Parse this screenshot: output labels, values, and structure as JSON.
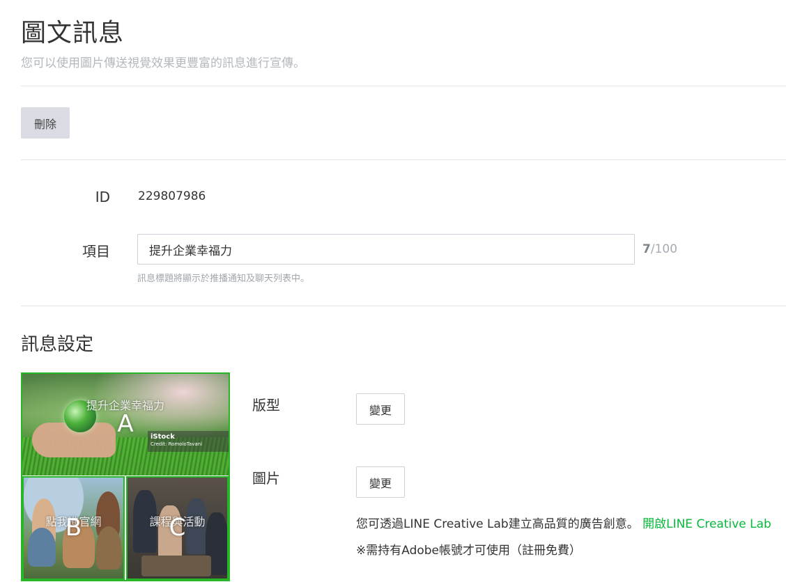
{
  "header": {
    "title": "圖文訊息",
    "subtitle": "您可以使用圖片傳送視覺效果更豐富的訊息進行宣傳。"
  },
  "actions": {
    "delete_label": "刪除"
  },
  "form": {
    "id_label": "ID",
    "id_value": "229807986",
    "item_label": "項目",
    "item_value": "提升企業幸福力",
    "counter_current": "7",
    "counter_max": "/100",
    "item_hint": "訊息標題將顯示於推播通知及聊天列表中。"
  },
  "settings": {
    "section_title": "訊息設定",
    "layout_label": "版型",
    "layout_button": "變更",
    "image_label": "圖片",
    "image_button": "變更",
    "lab_text": "您可透過LINE Creative Lab建立高品質的廣告創意。",
    "lab_link": "開啟LINE Creative Lab",
    "note": "※需持有Adobe帳號才可使用（註冊免費）"
  },
  "preview": {
    "area_a": {
      "letter": "A",
      "caption": "提升企業幸福力",
      "watermark_1": "iStock",
      "watermark_2": "Credit: RomoloTavani"
    },
    "area_b": {
      "letter": "B",
      "caption": "點我進官網"
    },
    "area_c": {
      "letter": "C",
      "caption": "課程與活動"
    }
  },
  "colors": {
    "accent_green": "#27b627",
    "link_green": "#06b93a",
    "delete_bg": "#d9dde3"
  }
}
